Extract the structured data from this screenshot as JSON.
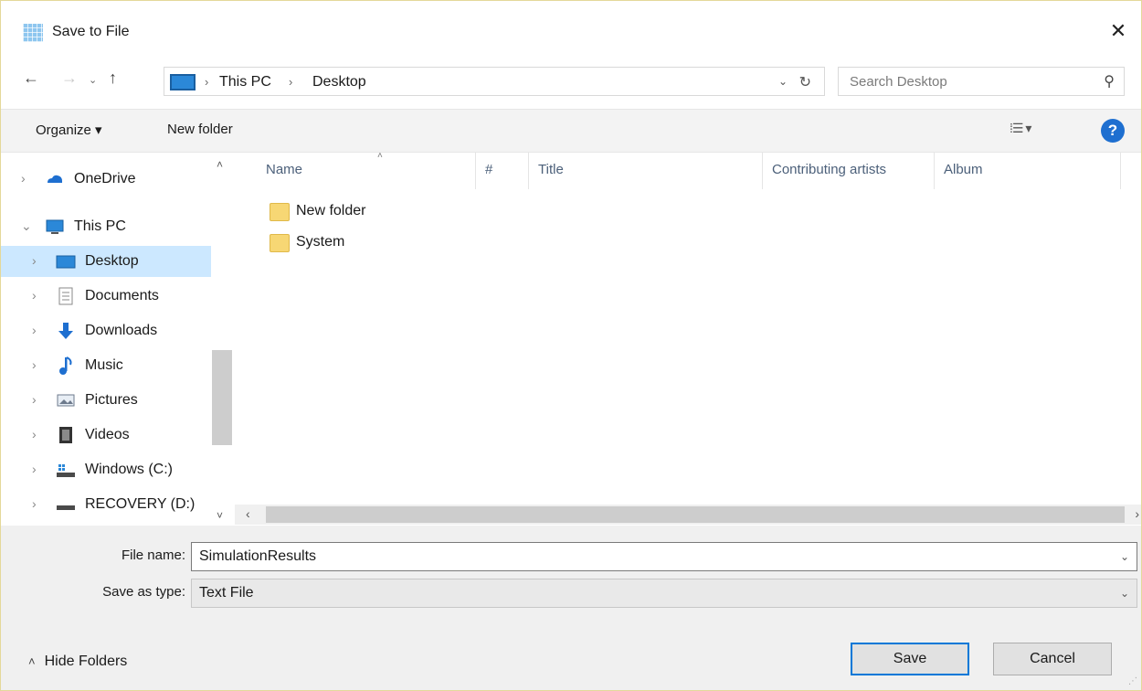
{
  "window": {
    "title": "Save to File",
    "close_glyph": "✕",
    "app_icon": "grid-app-icon"
  },
  "nav": {
    "back_glyph": "←",
    "forward_glyph": "→",
    "recent_glyph": "⌄",
    "up_glyph": "↑",
    "breadcrumb": [
      "This PC",
      "Desktop"
    ],
    "crumb_sep": "›",
    "dropdown_glyph": "⌄",
    "refresh_glyph": "↻"
  },
  "search": {
    "placeholder": "Search Desktop",
    "icon_glyph": "⚲"
  },
  "toolbar": {
    "organize_label": "Organize ▾",
    "new_folder_label": "New folder",
    "view_glyph": "⁞☰ ▾",
    "help_glyph": "?"
  },
  "tree": {
    "items": [
      {
        "label": "OneDrive",
        "icon": "onedrive-icon",
        "chev": "›",
        "color": "#1e6fd0"
      },
      {
        "label": "This PC",
        "icon": "this-pc-icon",
        "chev": "⌄",
        "color": "#2b88d8"
      },
      {
        "label": "Desktop",
        "icon": "desktop-icon",
        "chev": "›",
        "color": "#2b88d8",
        "selected": true
      },
      {
        "label": "Documents",
        "icon": "documents-icon",
        "chev": "›",
        "color": "#9a9a9a"
      },
      {
        "label": "Downloads",
        "icon": "downloads-icon",
        "chev": "›",
        "color": "#1e6fd0"
      },
      {
        "label": "Music",
        "icon": "music-icon",
        "chev": "›",
        "color": "#1e6fd0"
      },
      {
        "label": "Pictures",
        "icon": "pictures-icon",
        "chev": "›",
        "color": "#6d7a8c"
      },
      {
        "label": "Videos",
        "icon": "videos-icon",
        "chev": "›",
        "color": "#333333"
      },
      {
        "label": "Windows (C:)",
        "icon": "drive-c-icon",
        "chev": "›",
        "color": "#4a4a4a"
      },
      {
        "label": "RECOVERY (D:)",
        "icon": "drive-d-icon",
        "chev": "›",
        "color": "#4a4a4a"
      }
    ],
    "scroll_up_glyph": "˄",
    "scroll_down_glyph": "˅"
  },
  "columns": [
    "Name",
    "#",
    "Title",
    "Contributing artists",
    "Album"
  ],
  "sort_glyph": "˄",
  "files": [
    "New folder",
    "System"
  ],
  "hscroll": {
    "left_glyph": "‹",
    "right_glyph": "›"
  },
  "form": {
    "file_name_label": "File name:",
    "file_name_value": "SimulationResults",
    "save_type_label": "Save as type:",
    "save_type_value": "Text File",
    "dropdown_glyph": "⌄"
  },
  "footer": {
    "hide_folders_label": "Hide Folders",
    "hide_caret": "˄",
    "save_label": "Save",
    "cancel_label": "Cancel"
  },
  "colors": {
    "accent": "#0078d7",
    "selection": "#cce8ff",
    "folder": "#f7d774"
  }
}
